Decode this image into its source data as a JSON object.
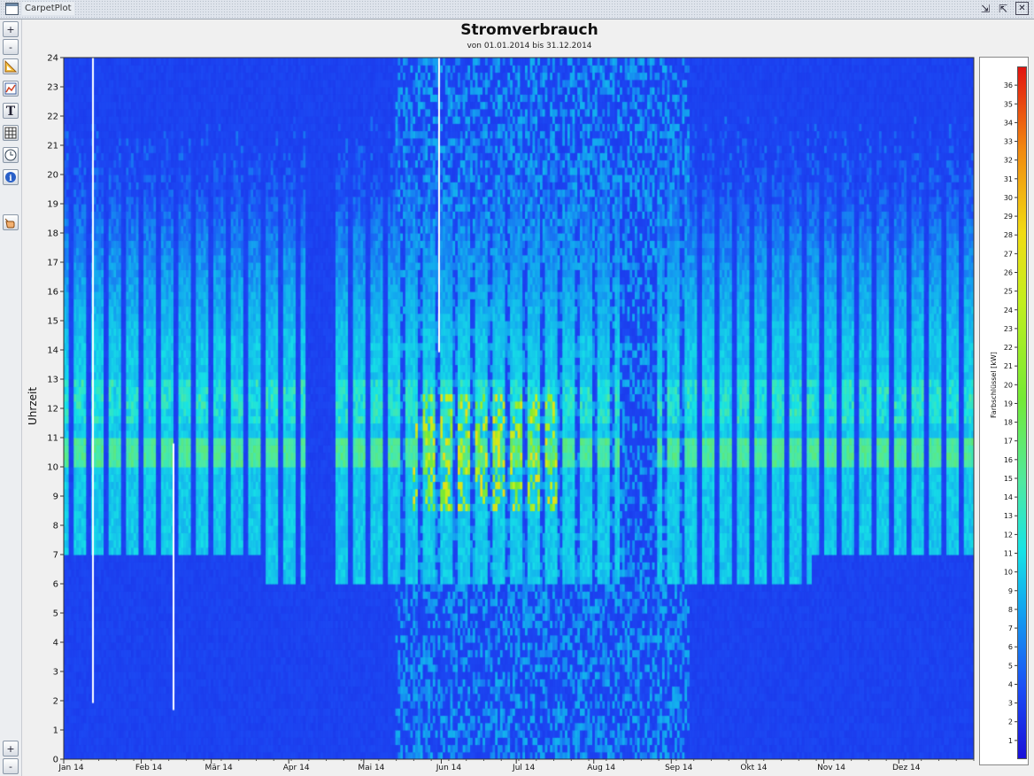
{
  "window": {
    "title": "CarpetPlot",
    "controls": [
      {
        "icon": "restore-down-icon",
        "glyph": "⇲"
      },
      {
        "icon": "maximize-icon",
        "glyph": "⇱"
      },
      {
        "icon": "close-icon",
        "glyph": "✕"
      }
    ]
  },
  "toolbar": {
    "zoom_in_top": "+",
    "zoom_out_top": "-",
    "zoom_in_bottom": "+",
    "zoom_out_bottom": "-",
    "tools": [
      "axis-settings-icon",
      "chart-edit-icon",
      "text-tool-icon",
      "grid-icon",
      "time-icon",
      "info-icon",
      "hand-pointer-icon"
    ]
  },
  "chart_data": {
    "type": "heatmap",
    "title": "Stromverbrauch",
    "subtitle": "von 01.01.2014 bis 31.12.2014",
    "ylabel": "Uhrzeit",
    "xlabel": "",
    "ylim": [
      0,
      24
    ],
    "yticks": [
      0,
      1,
      2,
      3,
      4,
      5,
      6,
      7,
      8,
      9,
      10,
      11,
      12,
      13,
      14,
      15,
      16,
      17,
      18,
      19,
      20,
      21,
      22,
      23,
      24
    ],
    "x_tick_labels": [
      "Jan 14",
      "Feb 14",
      "Mär 14",
      "Apr 14",
      "Mai 14",
      "Jun 14",
      "Jul 14",
      "Aug 14",
      "Sep 14",
      "Okt 14",
      "Nov 14",
      "Dez 14"
    ],
    "x_range_days": [
      1,
      365
    ],
    "colorbar": {
      "label": "Farbschlüssel [kW]",
      "min": 0,
      "max": 37,
      "ticks": [
        1,
        2,
        3,
        4,
        5,
        6,
        7,
        8,
        9,
        10,
        11,
        12,
        13,
        14,
        15,
        16,
        17,
        18,
        19,
        20,
        21,
        22,
        23,
        24,
        25,
        26,
        27,
        28,
        29,
        30,
        31,
        32,
        33,
        34,
        35,
        36
      ],
      "colors": [
        "#1a10d8",
        "#1c4df5",
        "#13a8ef",
        "#16e3e6",
        "#4fe9a0",
        "#74ea35",
        "#c2ef1e",
        "#f1dc13",
        "#f28a10",
        "#e21410"
      ]
    },
    "typical_values_kw": {
      "base_load_night": 3,
      "workday_hours": 9,
      "workday_morning_peak_10_11": 15,
      "summer_peak": 26
    },
    "workday_start_hour": {
      "winter": 7,
      "spring_autumn": 6
    },
    "gaps": [
      {
        "label": "Apr 14",
        "from_day": 98,
        "to_day": 108
      },
      {
        "label": "Sep 14",
        "from_day": 224,
        "to_day": 238
      }
    ],
    "noisy_period": {
      "from_day": 134,
      "to_day": 251
    }
  }
}
